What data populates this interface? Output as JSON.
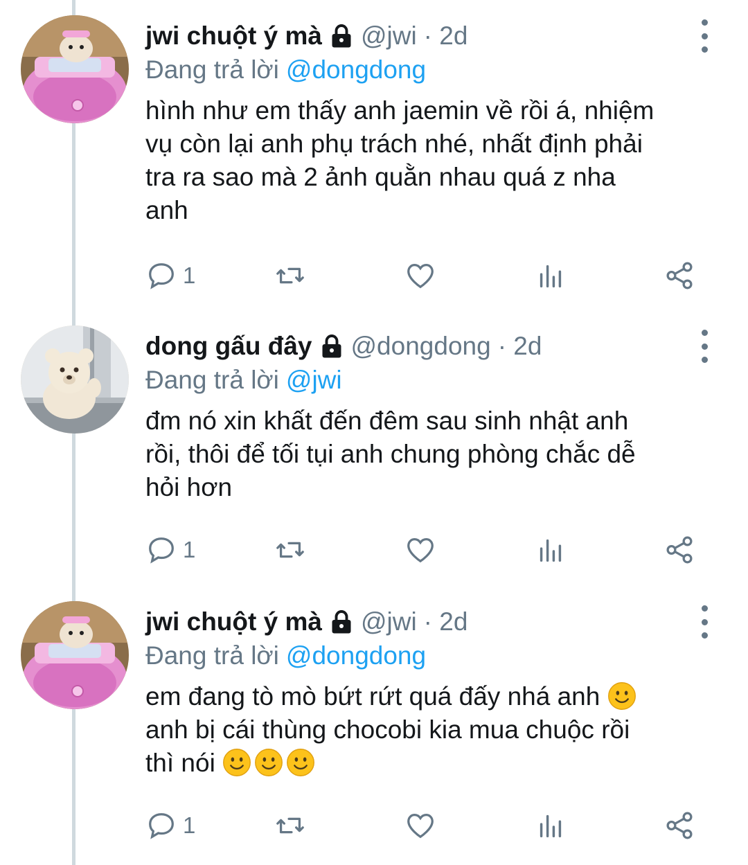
{
  "tweets": [
    {
      "name": "jwi chuột ý mà",
      "handle": "@jwi",
      "time": "· 2d",
      "replying_label": "Đang trả lời",
      "replying_to": "@dongdong",
      "body_lines": [
        "hình như em thấy anh jaemin về rồi á, nhiệm",
        "vụ còn lại anh phụ trách nhé, nhất định phải",
        "tra ra sao mà 2 ảnh quằn nhau quá z nha",
        "anh"
      ],
      "reply_count": "1",
      "avatar_icon": "hamster-in-pink-car-avatar"
    },
    {
      "name": "dong gấu đây",
      "handle": "@dongdong",
      "time": "· 2d",
      "replying_label": "Đang trả lời",
      "replying_to": "@jwi",
      "body_lines": [
        "đm nó xin khất đến đêm sau sinh nhật anh",
        "rồi, thôi để tối tụi anh chung phòng chắc dễ",
        "hỏi hơn"
      ],
      "reply_count": "1",
      "avatar_icon": "teddy-bear-window-avatar"
    },
    {
      "name": "jwi chuột ý mà",
      "handle": "@jwi",
      "time": "· 2d",
      "replying_label": "Đang trả lời",
      "replying_to": "@dongdong",
      "body_lines": [
        "em đang tò mò bứt rứt quá đấy nhá anh",
        "anh bị cái thùng chocobi kia mua chuộc rồi",
        "thì nói"
      ],
      "reply_count": "1",
      "avatar_icon": "hamster-in-pink-car-avatar"
    }
  ],
  "colors": {
    "text": "#14171a",
    "secondary": "#657786",
    "link": "#1da1f2",
    "thread_line": "#cfd9de"
  }
}
